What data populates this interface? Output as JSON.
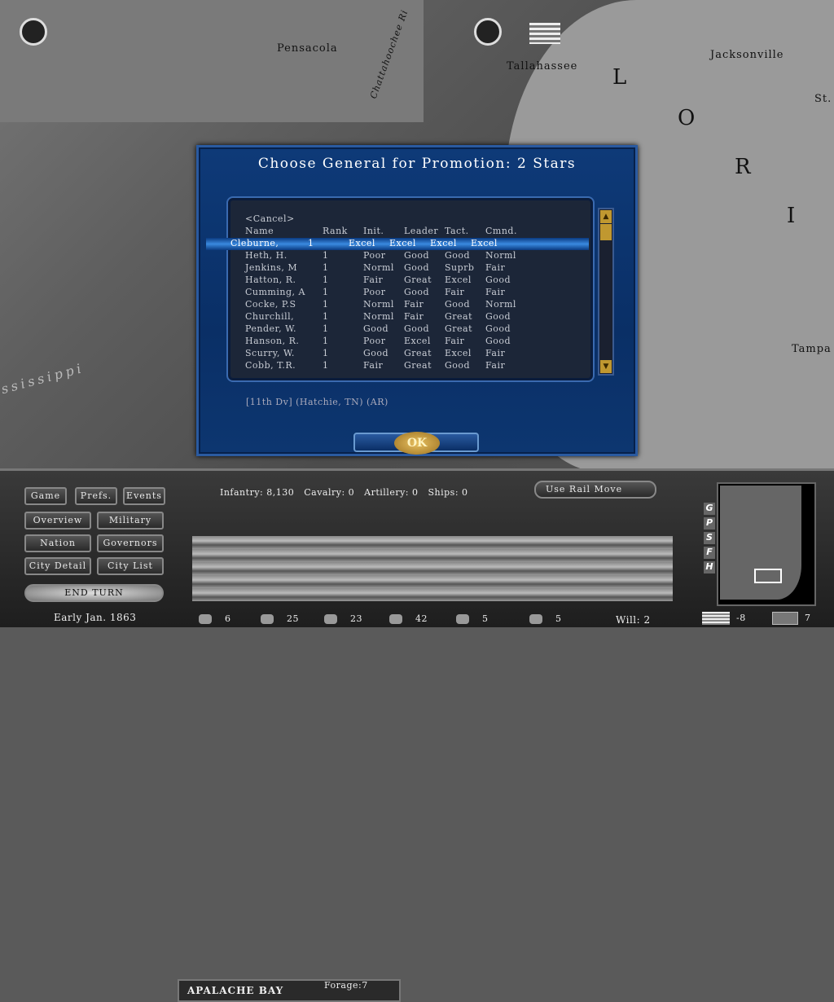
{
  "map": {
    "labels": [
      "Pensacola",
      "Tallahassee",
      "Jacksonville",
      "St.",
      "Tampa",
      "Chattahoochee Ri",
      "ssissippi"
    ],
    "state_letters": [
      "L",
      "O",
      "R",
      "I"
    ]
  },
  "dialog": {
    "title": "Choose General for Promotion: 2 Stars",
    "cancel": "<Cancel>",
    "columns": [
      "Name",
      "Rank",
      "Init.",
      "Leader",
      "Tact.",
      "Cmnd."
    ],
    "rows": [
      [
        "Cleburne,",
        "1",
        "Excel",
        "Excel",
        "Excel",
        "Excel"
      ],
      [
        "Heth, H.",
        "1",
        "Poor",
        "Good",
        "Good",
        "Norml"
      ],
      [
        "Jenkins, M",
        "1",
        "Norml",
        "Good",
        "Suprb",
        "Fair"
      ],
      [
        "Hatton, R.",
        "1",
        "Fair",
        "Great",
        "Excel",
        "Good"
      ],
      [
        "Cumming, A",
        "1",
        "Poor",
        "Good",
        "Fair",
        "Fair"
      ],
      [
        "Cocke, P.S",
        "1",
        "Norml",
        "Fair",
        "Good",
        "Norml"
      ],
      [
        "Churchill,",
        "1",
        "Norml",
        "Fair",
        "Great",
        "Good"
      ],
      [
        "Pender, W.",
        "1",
        "Good",
        "Good",
        "Great",
        "Good"
      ],
      [
        "Hanson, R.",
        "1",
        "Poor",
        "Excel",
        "Fair",
        "Good"
      ],
      [
        "Scurry, W.",
        "1",
        "Good",
        "Great",
        "Excel",
        "Fair"
      ],
      [
        "Cobb, T.R.",
        "1",
        "Fair",
        "Great",
        "Good",
        "Fair"
      ]
    ],
    "selected_index": 0,
    "info": "[11th Dv] (Hatchie, TN) (AR)",
    "ok": "OK",
    "scroll_up": "▲",
    "scroll_down": "▼"
  },
  "panel": {
    "buttons": [
      "Game",
      "Prefs.",
      "Events",
      "Overview",
      "Military",
      "Nation",
      "Governors",
      "City Detail",
      "City List"
    ],
    "end_turn": "END TURN",
    "date": "Early Jan. 1863",
    "stats": "Infantry: 8,130   Cavalry: 0   Artillery: 0   Ships: 0",
    "rail": "Use Rail Move",
    "location": "APALACHE BAY",
    "forage": "Forage:7",
    "tabs": [
      "G",
      "P",
      "S",
      "F",
      "H"
    ],
    "resources": [
      {
        "icon": "coin-icon",
        "value": "6"
      },
      {
        "icon": "tools-icon",
        "value": "25"
      },
      {
        "icon": "ammo-icon",
        "value": "23"
      },
      {
        "icon": "horses-icon",
        "value": "42"
      },
      {
        "icon": "rifle-icon",
        "value": "5"
      },
      {
        "icon": "rail-icon",
        "value": "5"
      }
    ],
    "will": "Will: 2",
    "union_value": "-8",
    "csa_value": "7"
  }
}
